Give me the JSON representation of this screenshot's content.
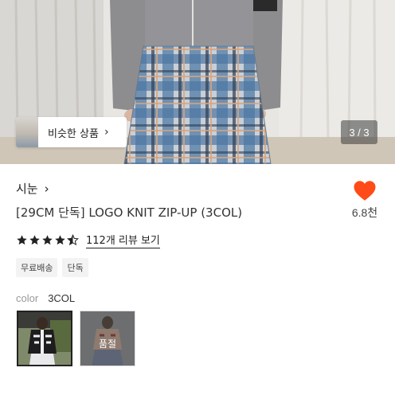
{
  "hero": {
    "similar_button_label": "비슷한 상품",
    "page_counter": "3 / 3"
  },
  "product": {
    "brand": "시눈",
    "title": "[29CM 단독] LOGO KNIT ZIP-UP (3COL)",
    "like_count": "6.8천",
    "rating": 4.5,
    "review_link": "112개 리뷰 보기",
    "badges": [
      "무료배송",
      "단독"
    ],
    "color_label": "color",
    "color_value": "3COL",
    "swatches": [
      {
        "selected": true,
        "sold_out": false
      },
      {
        "selected": false,
        "sold_out": true,
        "sold_out_label": "품절"
      }
    ]
  },
  "colors": {
    "heart": "#ff4b17",
    "star": "#222222"
  },
  "icons": [
    "chevron-right-icon",
    "heart-icon",
    "star-icon"
  ]
}
